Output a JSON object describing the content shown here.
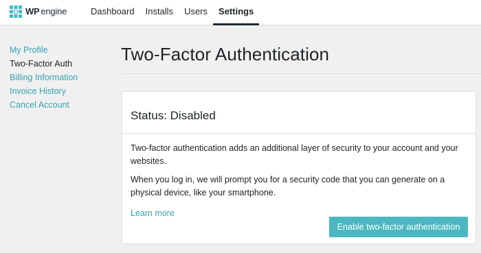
{
  "header": {
    "logo": {
      "wp": "WP",
      "engine": "engine",
      "brand_color": "#40bac8",
      "icon": "wpengine-logo-icon"
    },
    "nav": [
      {
        "label": "Dashboard",
        "active": false
      },
      {
        "label": "Installs",
        "active": false
      },
      {
        "label": "Users",
        "active": false
      },
      {
        "label": "Settings",
        "active": true
      }
    ]
  },
  "sidebar": {
    "items": [
      {
        "label": "My Profile",
        "current": false
      },
      {
        "label": "Two-Factor Auth",
        "current": true
      },
      {
        "label": "Billing Information",
        "current": false
      },
      {
        "label": "Invoice History",
        "current": false
      },
      {
        "label": "Cancel Account",
        "current": false
      }
    ]
  },
  "main": {
    "title": "Two-Factor Authentication",
    "card": {
      "status": "Status: Disabled",
      "paragraph1": "Two-factor authentication adds an additional layer of security to your account and your websites.",
      "paragraph2": "When you log in, we will prompt you for a security code that you can generate on a physical device, like your smartphone.",
      "learn_more": "Learn more",
      "button_label": "Enable two-factor authentication"
    }
  },
  "colors": {
    "accent": "#4bb8c1",
    "link": "#35a3b0",
    "background": "#f0f0f0"
  }
}
